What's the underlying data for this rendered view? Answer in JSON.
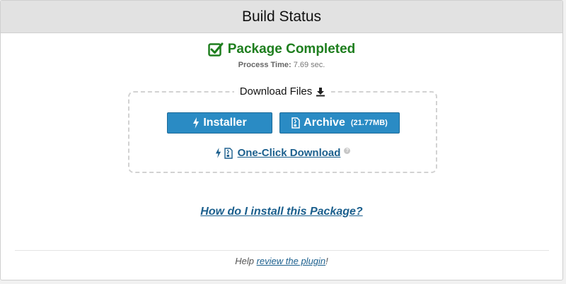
{
  "header": {
    "title": "Build Status"
  },
  "status": {
    "message": "Package Completed",
    "process_time_label": "Process Time:",
    "process_time_value": "7.69 sec.",
    "color": "#1e7e1e"
  },
  "downloads": {
    "legend": "Download Files",
    "installer_label": "Installer",
    "archive_label": "Archive",
    "archive_size": "(21.77MB)",
    "one_click_label": "One-Click Download",
    "button_color": "#2a8bc4",
    "icons": {
      "legend": "download-icon",
      "installer": "bolt-icon",
      "archive": "zip-file-icon",
      "one_click": [
        "bolt-icon",
        "zip-file-icon"
      ],
      "help": "question-icon"
    },
    "help_glyph": "?"
  },
  "help_link": {
    "label": "How do I install this Package?"
  },
  "footer": {
    "prefix": "Help",
    "link_label": "review the plugin",
    "suffix": "!"
  },
  "link_color": "#1b5f8d"
}
